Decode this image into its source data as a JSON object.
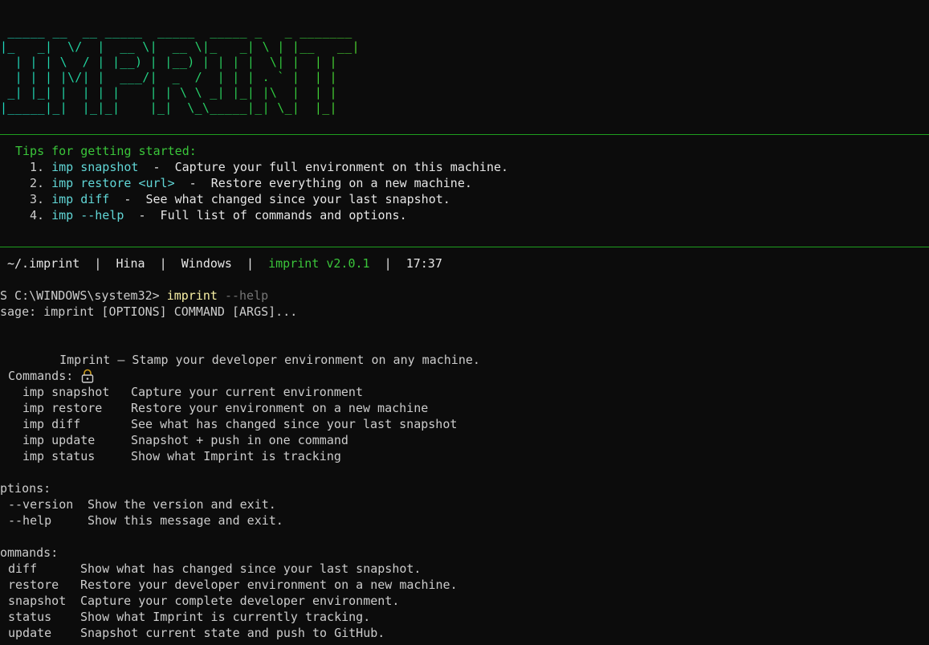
{
  "banner": {
    "ascii": " _____ __  __ _____  _____  _____ _   _ _______\n|_   _|  \\/  |  __ \\|  __ \\|_   _| \\ | |__   __|\n  | | | \\  / | |__) | |__) | | | |  \\| |  | |\n  | | | |\\/| |  ___/|  _  /  | | | . ` |  | |\n _| |_| |  | | |    | | \\ \\ _| |_| |\\  |  | |\n|_____|_|  |_|_|    |_|  \\_\\_____|_| \\_|  |_|"
  },
  "tips": {
    "heading": "Tips for getting started:",
    "items": [
      {
        "num": "1.",
        "cmd_prefix": "imp",
        "cmd": "snapshot",
        "desc": "  -  Capture your full environment on this machine."
      },
      {
        "num": "2.",
        "cmd_prefix": "imp",
        "cmd": "restore <url>",
        "desc": "  -  Restore everything on a new machine."
      },
      {
        "num": "3.",
        "cmd_prefix": "imp",
        "cmd": "diff",
        "desc": "  -  See what changed since your last snapshot."
      },
      {
        "num": "4.",
        "cmd_prefix": "imp",
        "cmd": "--help",
        "desc": "  -  Full list of commands and options."
      }
    ]
  },
  "statusbar": {
    "path": "~/.imprint",
    "user": "Hina",
    "os": "Windows",
    "version": "imprint v2.0.1",
    "time": "17:37",
    "separator": "|"
  },
  "prompt": {
    "path": "S C:\\WINDOWS\\system32>",
    "command": "imprint",
    "args": "--help"
  },
  "output": {
    "usage": "sage: imprint [OPTIONS] COMMAND [ARGS]...",
    "lock_icon": "lock-icon",
    "description": "Imprint — Stamp your developer environment on any machine.",
    "commands_heading": "Commands:",
    "imp_commands": [
      {
        "name": "imp snapshot",
        "desc": "Capture your current environment"
      },
      {
        "name": "imp restore",
        "desc": "Restore your environment on a new machine"
      },
      {
        "name": "imp diff",
        "desc": "See what has changed since your last snapshot"
      },
      {
        "name": "imp update",
        "desc": "Snapshot + push in one command"
      },
      {
        "name": "imp status",
        "desc": "Show what Imprint is tracking"
      }
    ],
    "options_heading": "ptions:",
    "options": [
      {
        "flag": "--version",
        "desc": "Show the version and exit."
      },
      {
        "flag": "--help",
        "desc": "Show this message and exit."
      }
    ],
    "commands2_heading": "ommands:",
    "commands2": [
      {
        "name": "diff",
        "desc": "Show what has changed since your last snapshot."
      },
      {
        "name": "restore",
        "desc": "Restore your developer environment on a new machine."
      },
      {
        "name": "snapshot",
        "desc": "Capture your complete developer environment."
      },
      {
        "name": "status",
        "desc": "Show what Imprint is currently tracking."
      },
      {
        "name": "update",
        "desc": "Snapshot current state and push to GitHub."
      }
    ]
  },
  "colors": {
    "background": "#0c0c0c",
    "text": "#cccccc",
    "green": "#3ac53a",
    "cyan": "#61d6d6",
    "divider": "#1e9e1e"
  }
}
